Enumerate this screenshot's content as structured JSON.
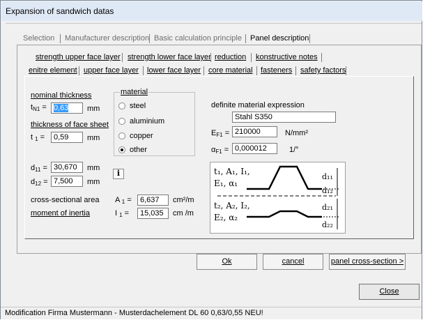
{
  "window": {
    "title": "Expansion of sandwich datas"
  },
  "top_tabs": [
    {
      "label": "Selection",
      "active": false
    },
    {
      "label": "Manufacturer description",
      "active": false
    },
    {
      "label": "Basic calculation principle",
      "active": false
    },
    {
      "label": "Panel description",
      "active": true
    }
  ],
  "sub_tabs_row1": [
    {
      "label": "strength upper face layer"
    },
    {
      "label": "strength lower face layer"
    },
    {
      "label": "reduction"
    },
    {
      "label": "konstructive notes"
    }
  ],
  "sub_tabs_row2": [
    {
      "label": "enitre element"
    },
    {
      "label": "upper face layer",
      "active": true
    },
    {
      "label": "lower face layer"
    },
    {
      "label": "core material"
    },
    {
      "label": "fasteners"
    },
    {
      "label": "safety factors"
    }
  ],
  "form": {
    "nominal_thickness_label": "nominal thickness",
    "tn1_label": "t",
    "tn1_sub": "N1",
    "tn1_eq": "=",
    "tn1_value": "0,63",
    "tn1_unit": "mm",
    "face_sheet_label": "thickness of face sheet",
    "t1_label": "t",
    "t1_sub": "1",
    "t1_eq": "=",
    "t1_value": "0,59",
    "t1_unit": "mm",
    "d11_label": "d",
    "d11_sub": "11",
    "d11_eq": "=",
    "d11_value": "30,670",
    "d11_unit": "mm",
    "d12_label": "d",
    "d12_sub": "12",
    "d12_eq": "=",
    "d12_value": "7,500",
    "d12_unit": "mm",
    "info_button": "i",
    "cross_area_label": "cross-sectional area",
    "a1_label": "A",
    "a1_sub": "1",
    "a1_eq": "=",
    "a1_value": "6,637",
    "a1_unit": "cm²/m",
    "inertia_label": "moment of inertia",
    "i1_label": "I",
    "i1_sub": "1",
    "i1_eq": "=",
    "i1_value": "15,035",
    "i1_unit": "cm  /m"
  },
  "material": {
    "group_label": "material",
    "options": [
      {
        "label": "steel",
        "checked": false
      },
      {
        "label": "aluminium",
        "checked": false
      },
      {
        "label": "copper",
        "checked": false
      },
      {
        "label": "other",
        "checked": true
      }
    ],
    "definite_label": "definite material expression",
    "expression_value": "Stahl S350",
    "ef1_label": "E",
    "ef1_sub": "F1",
    "ef1_eq": "=",
    "ef1_value": "210000",
    "ef1_unit": "N/mm²",
    "af1_label": "α",
    "af1_sub": "F1",
    "af1_eq": "=",
    "af1_value": "0,000012",
    "af1_unit": "1/°"
  },
  "diagram": {
    "upper_line1": "t₁, A₁, I₁,",
    "upper_line2": "E₁, α₁",
    "lower_line1": "t₂, A₂, I₂,",
    "lower_line2": "E₂, α₂",
    "d11": "d₁₁",
    "d12": "d₁₂",
    "d21": "d₂₁",
    "d22": "d₂₂"
  },
  "buttons": {
    "ok": "Ok",
    "cancel": "cancel",
    "panel_cross_section": "panel cross-section >",
    "close": "Close"
  },
  "status_bar": "Modification Firma Mustermann - Musterdachelement DL 60 0,63/0,55 NEU!"
}
